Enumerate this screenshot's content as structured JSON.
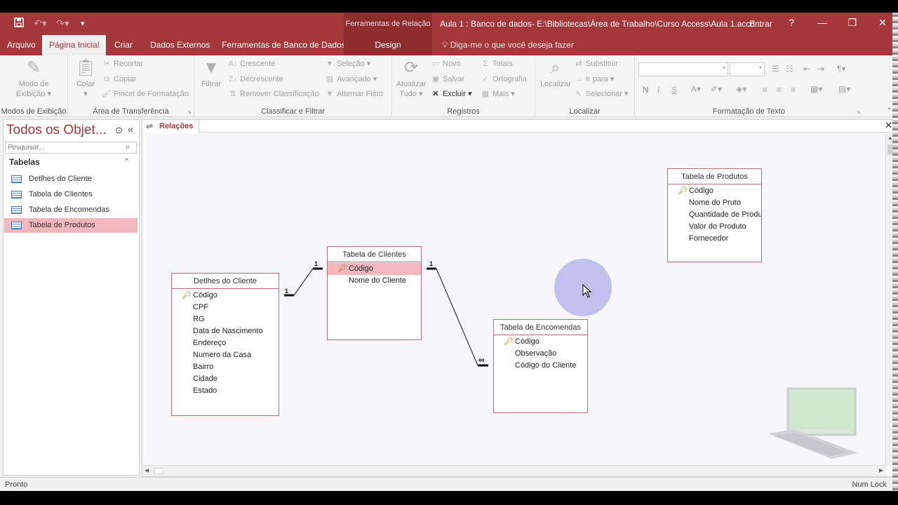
{
  "titlebar": {
    "save_icon": "save-icon",
    "undo_icon": "undo-icon",
    "redo_icon": "redo-icon",
    "customize_icon": "customize-icon",
    "context_title": "Ferramentas de Relação",
    "doc_title": "Aula 1 : Banco de dados- E:\\Bibliotecas\\Área de Trabalho\\Curso Access\\Aula 1.accd...",
    "signin": "Entrar",
    "help": "?",
    "minimize": "—",
    "restore": "❐",
    "close": "✕"
  },
  "tabs": {
    "arquivo": "Arquivo",
    "pagina_inicial": "Página Inicial",
    "criar": "Criar",
    "dados_externos": "Dados Externos",
    "ferramentas_bd": "Ferramentas de Banco de Dados",
    "design": "Design",
    "tell_me": "Diga-me o que você deseja fazer"
  },
  "ribbon": {
    "views": {
      "button": "Modo de",
      "button2": "Exibição",
      "label": "Modos de Exibição"
    },
    "clipboard": {
      "paste": "Colar",
      "cut": "Recortar",
      "copy": "Copiar",
      "format_painter": "Pincel de Formatação",
      "label": "Área de Transferência"
    },
    "sort_filter": {
      "filter": "Filtrar",
      "ascending": "Crescente",
      "descending": "Decrescente",
      "remove_sort": "Remover Classificação",
      "selection": "Seleção",
      "advanced": "Avançado",
      "toggle_filter": "Alternar Filtro",
      "label": "Classificar e Filtrar"
    },
    "records": {
      "refresh": "Atualizar",
      "refresh2": "Tudo",
      "new": "Novo",
      "save": "Salvar",
      "delete": "Excluir",
      "totals": "Totais",
      "spelling": "Ortografia",
      "more": "Mais",
      "label": "Registros"
    },
    "find": {
      "find": "Localizar",
      "replace": "Substituir",
      "goto": "Ir para",
      "select": "Selecionar",
      "label": "Localizar"
    },
    "text_format": {
      "bold": "N",
      "italic": "I",
      "underline": "S",
      "label": "Formatação de Texto"
    }
  },
  "nav": {
    "title": "Todos os Objet...",
    "search_placeholder": "Pesquisar...",
    "section": "Tabelas",
    "items": [
      {
        "label": "Detlhes do Cliente",
        "selected": false
      },
      {
        "label": "Tabela de Clientes",
        "selected": false
      },
      {
        "label": "Tabela de Encomendas",
        "selected": false
      },
      {
        "label": "Tabela de Produtos",
        "selected": true
      }
    ]
  },
  "document": {
    "tab": "Relações",
    "close": "✕",
    "tables": {
      "detalhes": {
        "title": "Detlhes do Cliente",
        "fields": [
          "Código",
          "CPF",
          "RG",
          "Data de Nascimento",
          "Endereço",
          "Numero da Casa",
          "Bairro",
          "Cidade",
          "Estado"
        ]
      },
      "clientes": {
        "title": "Tabela de Clientes",
        "fields": [
          "Código",
          "Nome do Cliente"
        ]
      },
      "encomendas": {
        "title": "Tabela de Encomendas",
        "fields": [
          "Código",
          "Observação",
          "Código do Cliente"
        ]
      },
      "produtos": {
        "title": "Tabela de Produtos",
        "fields": [
          "Código",
          "Nome do Pruto",
          "Quantidade de Produ",
          "Valor do Produto",
          "Fornecedor"
        ]
      }
    },
    "relations": {
      "one": "1",
      "many": "∞"
    }
  },
  "status": {
    "left": "Pronto",
    "right": "Num Lock"
  },
  "colors": {
    "accent": "#a4373a",
    "selection": "#f2b7bd",
    "table_border": "#b56a74"
  }
}
